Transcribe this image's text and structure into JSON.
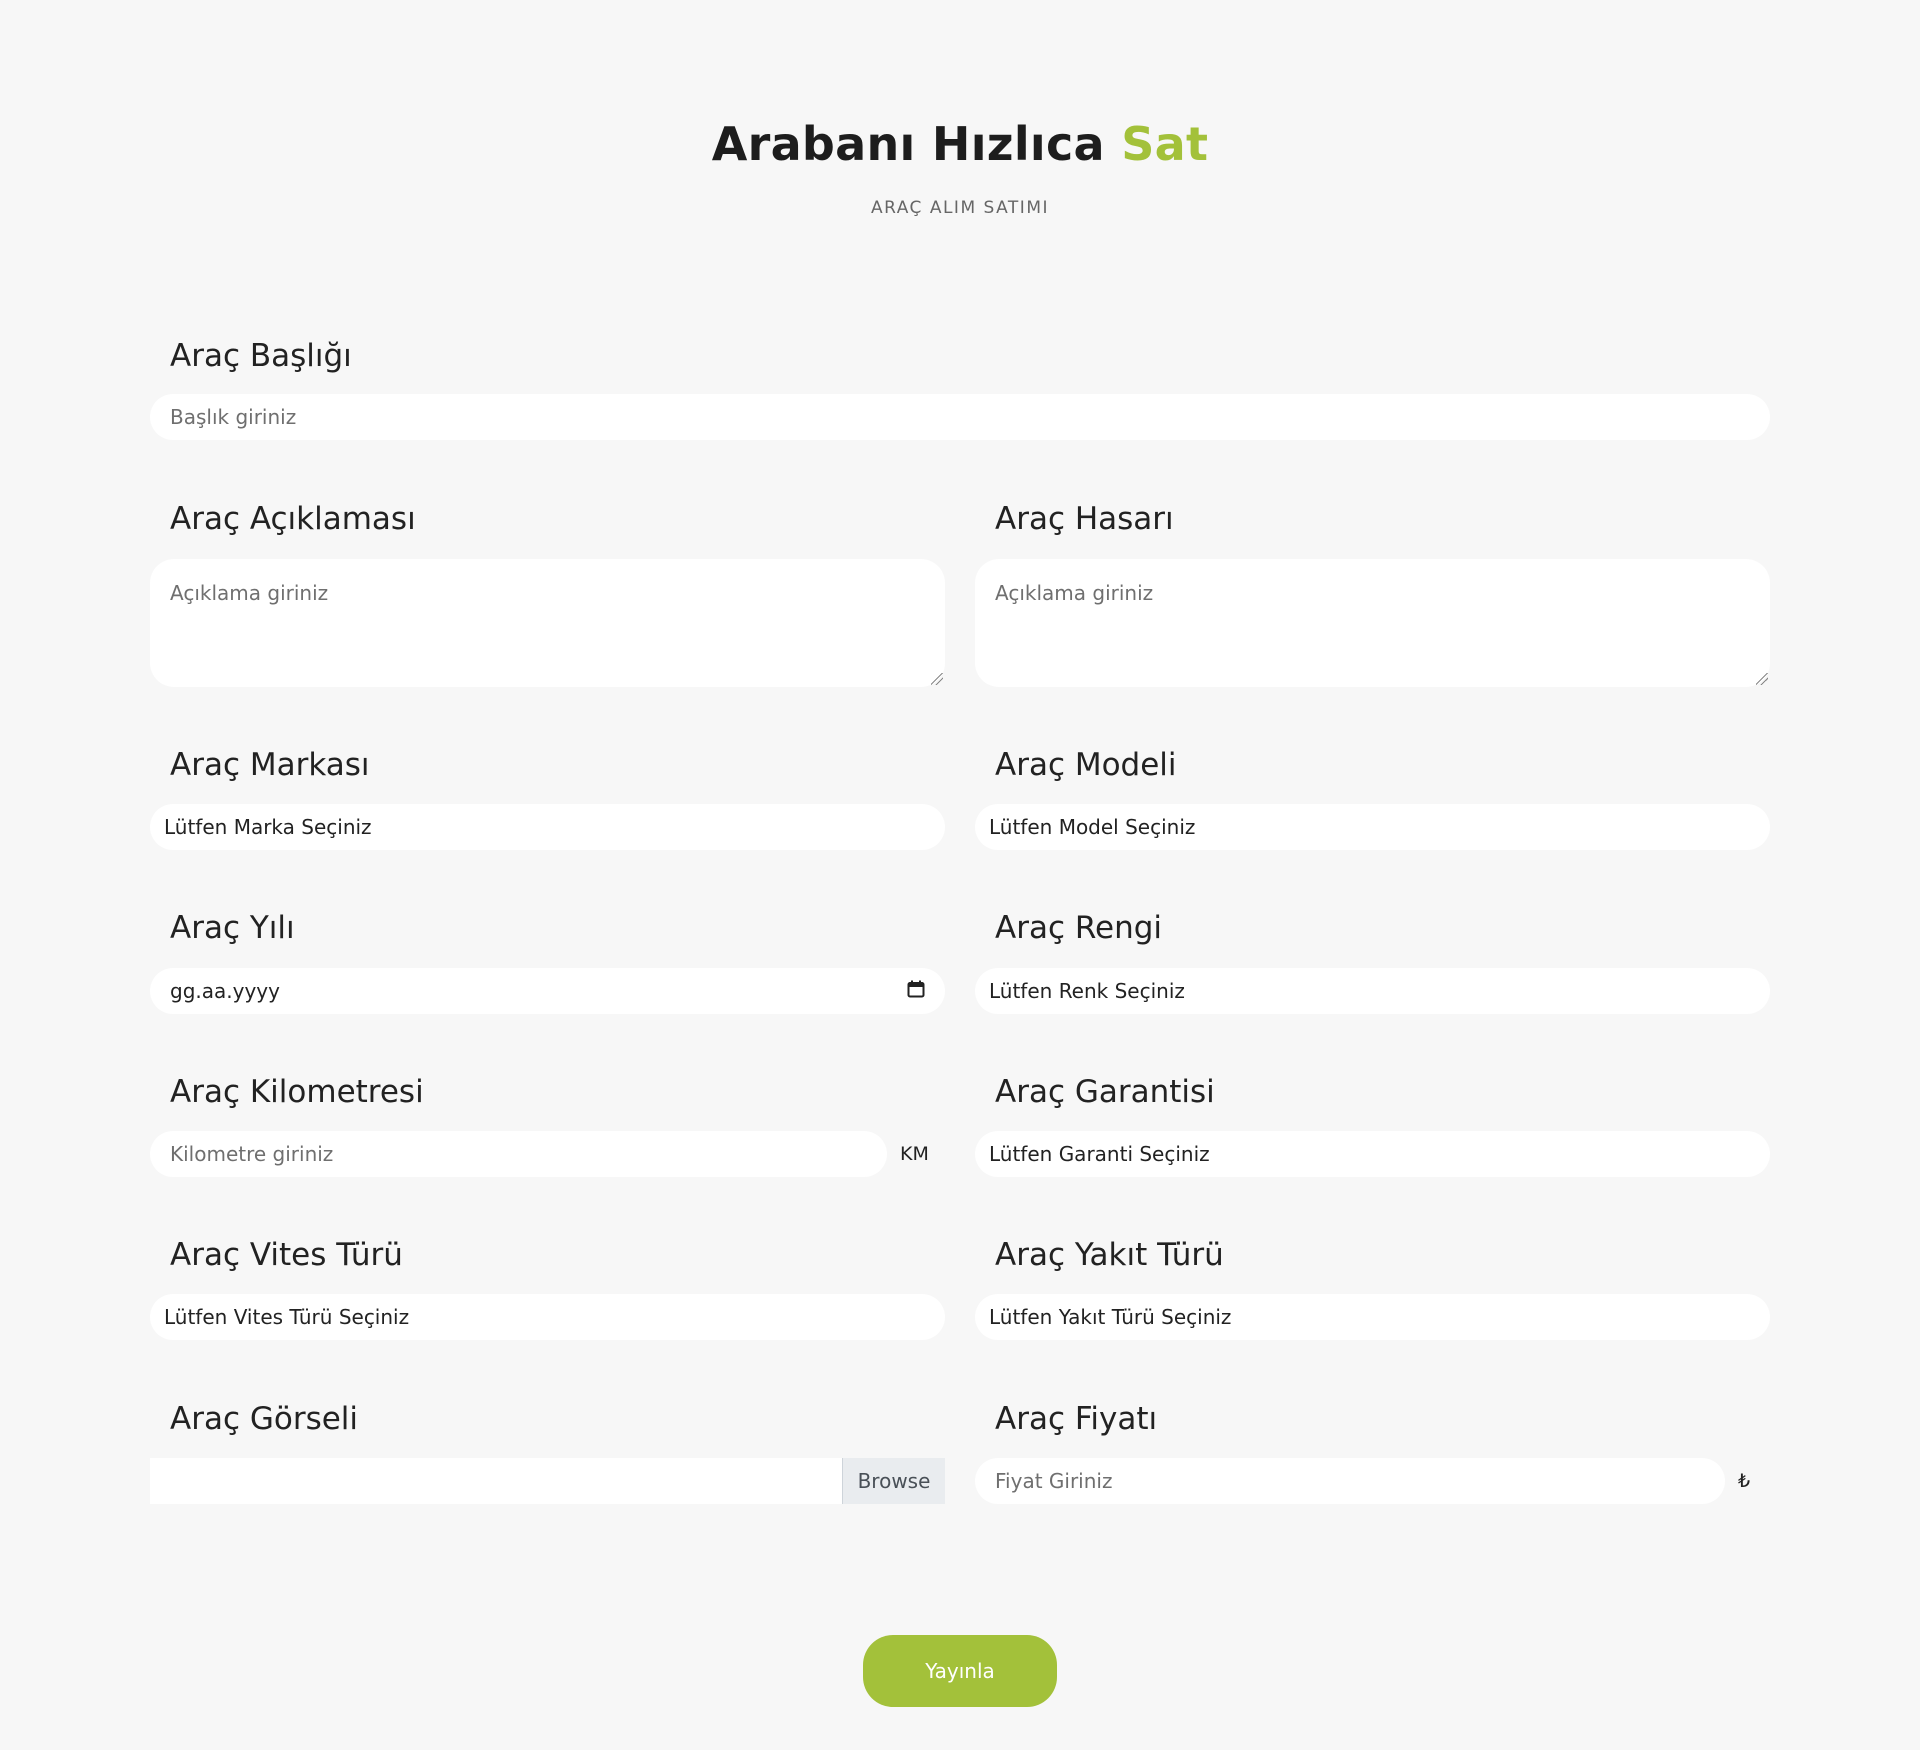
{
  "header": {
    "title_main": "Arabanı Hızlıca",
    "title_accent": "Sat",
    "subtitle": "ARAÇ ALIM SATIMI",
    "accent_color": "#a3c13a"
  },
  "form": {
    "title": {
      "label": "Araç Başlığı",
      "placeholder": "Başlık giriniz"
    },
    "description": {
      "label": "Araç Açıklaması",
      "placeholder": "Açıklama giriniz"
    },
    "damage": {
      "label": "Araç Hasarı",
      "placeholder": "Açıklama giriniz"
    },
    "brand": {
      "label": "Araç Markası",
      "selected": "Lütfen Marka Seçiniz"
    },
    "model": {
      "label": "Araç Modeli",
      "selected": "Lütfen Model Seçiniz"
    },
    "year": {
      "label": "Araç Yılı",
      "placeholder": "gg.aa.yyyy",
      "icon": "calendar-icon"
    },
    "color": {
      "label": "Araç Rengi",
      "selected": "Lütfen Renk Seçiniz"
    },
    "mileage": {
      "label": "Araç Kilometresi",
      "placeholder": "Kilometre giriniz",
      "unit": "KM"
    },
    "warranty": {
      "label": "Araç Garantisi",
      "selected": "Lütfen Garanti Seçiniz"
    },
    "gearbox": {
      "label": "Araç Vites Türü",
      "selected": "Lütfen Vites Türü Seçiniz"
    },
    "fuel": {
      "label": "Araç Yakıt Türü",
      "selected": "Lütfen Yakıt Türü Seçiniz"
    },
    "image": {
      "label": "Araç Görseli",
      "browse_label": "Browse"
    },
    "price": {
      "label": "Araç Fiyatı",
      "placeholder": "Fiyat Giriniz",
      "currency": "₺"
    }
  },
  "actions": {
    "publish_label": "Yayınla"
  }
}
